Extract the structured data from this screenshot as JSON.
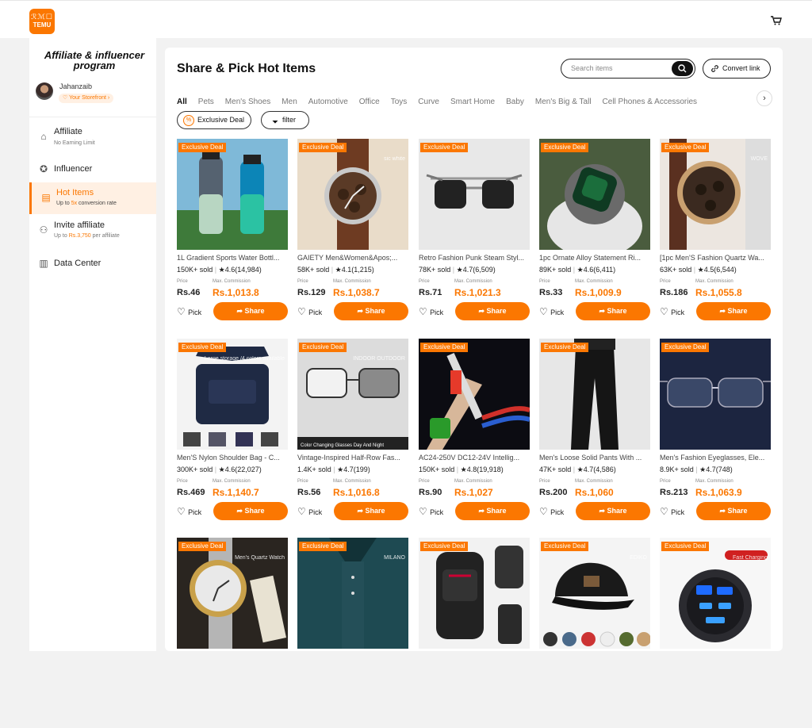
{
  "app": {
    "logo_line1": "ℛℳ☐",
    "logo_line2": "TEMU"
  },
  "sidebar": {
    "title": "Affiliate & influencer program",
    "user": {
      "name": "Jahanzaib",
      "storefront": "♡ Your Storefront ›"
    },
    "items": [
      {
        "label": "Affiliate",
        "sub_parts": [
          "No Earning Limit"
        ],
        "icon": "home-icon"
      },
      {
        "label": "Influencer",
        "sub_parts": [],
        "icon": "badge-icon"
      },
      {
        "label": "Hot Items",
        "sub_parts": [
          "Up to ",
          "5x",
          " conversion rate"
        ],
        "icon": "fire-icon"
      },
      {
        "label": "Invite affiliate",
        "sub_parts": [
          "Up to ",
          "Rs.3,750",
          " per affiliate"
        ],
        "icon": "person-add-icon"
      },
      {
        "label": "Data Center",
        "sub_parts": [],
        "icon": "chart-icon"
      }
    ]
  },
  "header": {
    "title": "Share & Pick Hot Items",
    "search_placeholder": "Search items",
    "convert_label": "Convert link"
  },
  "tabs": [
    "All",
    "Pets",
    "Men's Shoes",
    "Men",
    "Automotive",
    "Office",
    "Toys",
    "Curve",
    "Smart Home",
    "Baby",
    "Men's Big & Tall",
    "Cell Phones & Accessories"
  ],
  "filters": {
    "exclusive": "Exclusive Deal",
    "filter": "filter"
  },
  "labels": {
    "price": "Price",
    "max_commission": "Max. Commission",
    "pick": "Pick",
    "share": "Share",
    "badge": "Exclusive Deal"
  },
  "colors": {
    "accent": "#fb7701"
  },
  "products": [
    {
      "title": "1L Gradient Sports Water Bottl...",
      "sold": "150K+ sold",
      "rating": "4.6",
      "reviews": "(14,984)",
      "price": "Rs.46",
      "commission": "Rs.1,013.8",
      "thumb": "water-bottles"
    },
    {
      "title": "GAIETY Men&Women&Apos;...",
      "sold": "58K+ sold",
      "rating": "4.1",
      "reviews": "(1,215)",
      "price": "Rs.129",
      "commission": "Rs.1,038.7",
      "thumb": "brown-watch",
      "img_text": "sic white"
    },
    {
      "title": "Retro Fashion Punk Steam Styl...",
      "sold": "78K+ sold",
      "rating": "4.7",
      "reviews": "(6,509)",
      "price": "Rs.71",
      "commission": "Rs.1,021.3",
      "thumb": "sunglasses"
    },
    {
      "title": "1pc Ornate Alloy Statement Ri...",
      "sold": "89K+ sold",
      "rating": "4.6",
      "reviews": "(6,411)",
      "price": "Rs.33",
      "commission": "Rs.1,009.9",
      "thumb": "green-ring"
    },
    {
      "title": "[1pc Men'S Fashion Quartz Wa...",
      "sold": "63K+ sold",
      "rating": "4.5",
      "reviews": "(6,544)",
      "price": "Rs.186",
      "commission": "Rs.1,055.8",
      "thumb": "quartz-watch",
      "img_text": "WOVE"
    },
    {
      "title": "Men'S Nylon Shoulder Bag - C...",
      "sold": "300K+ sold",
      "rating": "4.6",
      "reviews": "(22,027)",
      "price": "Rs.469",
      "commission": "Rs.1,140.7",
      "thumb": "shoulder-bag",
      "img_text": "Large storage /4 colors available"
    },
    {
      "title": "Vintage-Inspired Half-Row Fas...",
      "sold": "1.4K+ sold",
      "rating": "4.7",
      "reviews": "(199)",
      "price": "Rs.56",
      "commission": "Rs.1,016.8",
      "thumb": "clear-glasses",
      "img_text": "INDOOR OUTDOOR",
      "img_caption": "Color Changing Glasses    Day And Night"
    },
    {
      "title": "AC24-250V DC12-24V Intellig...",
      "sold": "150K+ sold",
      "rating": "4.8",
      "reviews": "(19,918)",
      "price": "Rs.90",
      "commission": "Rs.1,027",
      "thumb": "tester-pen"
    },
    {
      "title": "Men's Loose Solid Pants With ...",
      "sold": "47K+ sold",
      "rating": "4.7",
      "reviews": "(4,586)",
      "price": "Rs.200",
      "commission": "Rs.1,060",
      "thumb": "black-pants"
    },
    {
      "title": "Men's Fashion Eyeglasses, Ele...",
      "sold": "8.9K+ sold",
      "rating": "4.7",
      "reviews": "(748)",
      "price": "Rs.213",
      "commission": "Rs.1,063.9",
      "thumb": "rimless-glasses"
    },
    {
      "title": "",
      "thumb": "silver-watch",
      "img_text": "Men's Quartz Watch"
    },
    {
      "title": "",
      "thumb": "polo-shirt",
      "img_text": "MILANO"
    },
    {
      "title": "",
      "thumb": "backpack"
    },
    {
      "title": "",
      "thumb": "baseball-cap",
      "img_text": "EDIKO"
    },
    {
      "title": "",
      "thumb": "car-charger",
      "img_text": "Fast Charging"
    }
  ]
}
